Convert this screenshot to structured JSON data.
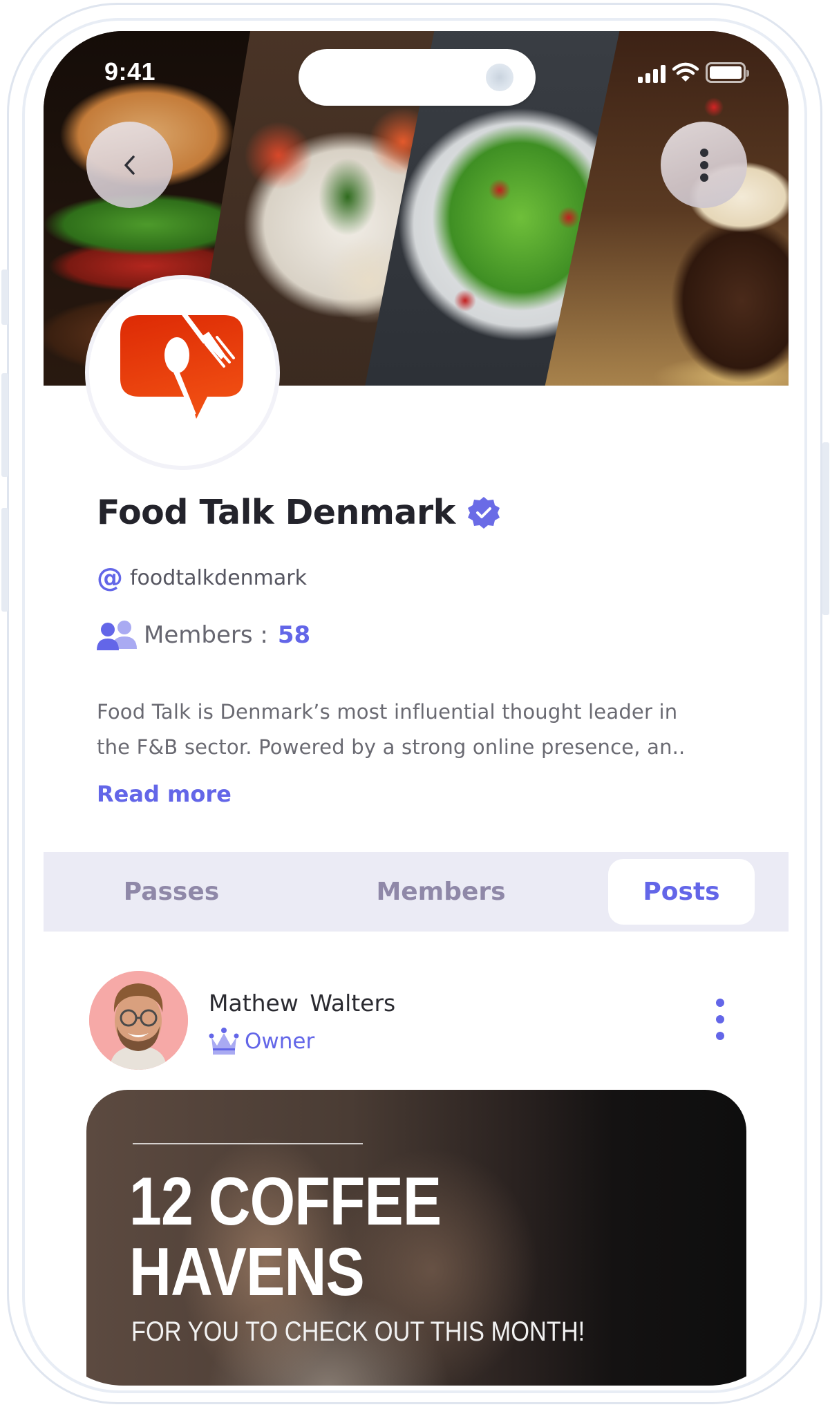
{
  "status_bar": {
    "time": "9:41"
  },
  "header": {
    "back_icon": "chevron-left-icon",
    "menu_icon": "more-vertical-icon"
  },
  "group": {
    "name": "Food Talk Denmark",
    "verified": true,
    "handle_prefix": "@",
    "handle": "foodtalkdenmark",
    "members_label": "Members :",
    "members_count": "58",
    "description_line1": "Food Talk is Denmark’s most influential thought leader in",
    "description_line2": "the F&B sector. Powered by a strong online presence, an..",
    "read_more": "Read more"
  },
  "tabs": [
    {
      "label": "Passes",
      "active": false
    },
    {
      "label": "Members",
      "active": false
    },
    {
      "label": "Posts",
      "active": true
    }
  ],
  "post": {
    "author_name": "Mathew  Walters",
    "author_role": "Owner",
    "headline_line1": "12 COFFEE",
    "headline_line2": "HAVENS",
    "subline": "FOR YOU TO CHECK OUT THIS MONTH!"
  },
  "colors": {
    "accent": "#6366e8",
    "title": "#23232b",
    "tab_bg": "#ebebf5",
    "tab_inactive": "#8f88a8",
    "logo_red": "#e8350f"
  }
}
